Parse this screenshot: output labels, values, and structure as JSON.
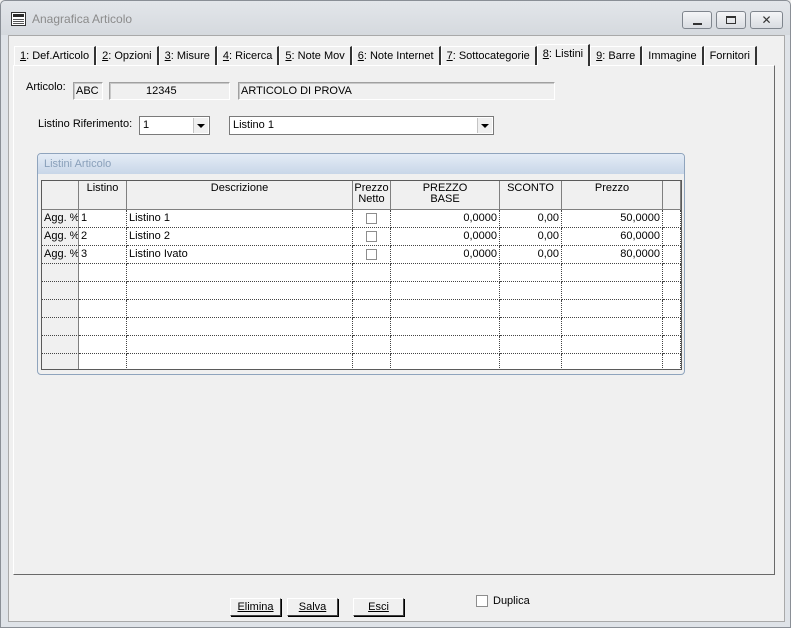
{
  "window": {
    "title": "Anagrafica Articolo"
  },
  "tabs": [
    {
      "key": "1",
      "label": ": Def.Articolo"
    },
    {
      "key": "2",
      "label": ": Opzioni"
    },
    {
      "key": "3",
      "label": ": Misure"
    },
    {
      "key": "4",
      "label": ": Ricerca"
    },
    {
      "key": "5",
      "label": ": Note Mov"
    },
    {
      "key": "6",
      "label": ": Note Internet"
    },
    {
      "key": "7",
      "label": ": Sottocategorie"
    },
    {
      "key": "8",
      "label": ": Listini"
    },
    {
      "key": "9",
      "label": ": Barre"
    },
    {
      "key": "",
      "label": "Immagine"
    },
    {
      "key": "",
      "label": "Fornitori"
    }
  ],
  "active_tab": "8",
  "articolo": {
    "label": "Articolo:",
    "code_prefix": "ABC",
    "code": "12345",
    "description": "ARTICOLO DI PROVA"
  },
  "listino_rif": {
    "label": "Listino Riferimento:",
    "number": "1",
    "name": "Listino 1"
  },
  "group": {
    "title": "Listini Articolo"
  },
  "grid": {
    "headers": [
      "Listino",
      "Descrizione",
      "Prezzo Netto",
      "PREZZO BASE",
      "SCONTO",
      "Prezzo"
    ],
    "rows": [
      {
        "rowhdr": "Agg. %",
        "listino": "1",
        "descrizione": "Listino 1",
        "netto": false,
        "base": "0,0000",
        "sconto": "0,00",
        "prezzo": "50,0000"
      },
      {
        "rowhdr": "Agg. %",
        "listino": "2",
        "descrizione": "Listino 2",
        "netto": false,
        "base": "0,0000",
        "sconto": "0,00",
        "prezzo": "60,0000"
      },
      {
        "rowhdr": "Agg. %",
        "listino": "3",
        "descrizione": "Listino Ivato",
        "netto": false,
        "base": "0,0000",
        "sconto": "0,00",
        "prezzo": "80,0000"
      }
    ],
    "empty_rows": 6
  },
  "buttons": {
    "elimina": "Elimina",
    "salva": "Salva",
    "esci": "Esci"
  },
  "duplica": {
    "label": "Duplica",
    "checked": false
  },
  "colors": {
    "group_header_text": "#8aa0ba",
    "title_text": "#8b8b8b"
  }
}
